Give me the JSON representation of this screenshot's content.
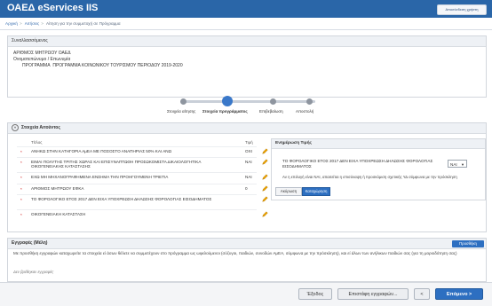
{
  "header": {
    "app_title": "ΟΑΕΔ eServices IIS",
    "logout_label": "Αποσύνδεση χρήστη"
  },
  "breadcrumb": {
    "items": [
      "Αρχική",
      "Αιτήσεις",
      "Αίτηση για την συμμετοχή σε Πρόγραμμα"
    ]
  },
  "applicant": {
    "title": "Συναλλασσόμενος",
    "registry_label": "ΑΡΙΘΜΟΣ ΜΗΤΡΩΟΥ ΟΑΕΔ",
    "name_label": "Ονοματεπώνυμο / Επωνυμία",
    "program_label": "ΠΡΟΓΡΑΜΜΑ",
    "program_value": "ΠΡΟΓΡΑΜΜΑ ΚΟΙΝΩΝΙΚΟΥ ΤΟΥΡΙΣΜΟΥ ΠΕΡΙΟΔΟΥ 2019-2020"
  },
  "wizard": {
    "steps": [
      {
        "label": "Στοιχεία αίτησης",
        "active": false
      },
      {
        "label": "Στοιχεία προγράμματος",
        "active": true
      },
      {
        "label": "Επιβεβαίωση",
        "active": false
      },
      {
        "label": "Αποστολή",
        "active": false
      }
    ]
  },
  "criteria": {
    "title": "Στοιχεία Αιτούντος",
    "col_title": "Τίτλος",
    "col_value": "Τιμή",
    "rows": [
      {
        "star": "*",
        "label": "ΑΝΗΚΩ ΣΤΗΝ ΚΑΤΗΓΟΡΙΑ ΑμΕΑ ΜΕ ΠΟΣΟΣΤΟ ΑΝΑΠΗΡΙΑΣ 50% ΚΑΙ ΑΝΩ",
        "value": "ΟΧΙ"
      },
      {
        "star": "*",
        "label": "ΕΙΜΑΙ ΠΟΛΥΤΗΣ ΤΡΙΤΗΣ ΧΩΡΑΣ ΚΑΙ ΕΠΙΣΥΝΑΠΤΩΘΗ ΠΡΟΣΩΚΟΜΙΣΤΑ ΔΙΚΑΙΟΛΟΓΗΤΙΚΑ ΟΙΚΟΓΕΝΕΙΑΚΗΣ ΚΑΤΑΣΤΑΣΗΣ",
        "value": "ΝΑΙ"
      },
      {
        "star": "*",
        "label": "ΕΧΩ ΜΗ ΜΗΧΑΝΟΓΡΑΦΗΜΕΝΑ ΕΝΣΗΜΑ ΤΗΝ ΠΡΟΗΓΟΥΜΕΝΗ ΤΡΙΕΤΙΑ",
        "value": "ΝΑΙ"
      },
      {
        "star": "*",
        "label": "ΑΡΙΘΜΟΣ ΜΗΤΡΩΟΥ ΕΦΚΑ",
        "value": "0"
      },
      {
        "star": "*",
        "label": "ΤΟ ΦΟΡΟΛΟΓΙΚΟ ΕΤΟΣ 2017 ΔΕΝ ΕΙΧΑ ΥΠΟΧΡΕΩΣΗ ΔΗΛΩΣΗΣ ΦΟΡΟΛΟΓΙΑΣ ΕΙΣΟΔΗΜΑΤΟΣ",
        "value": ""
      },
      {
        "star": "*",
        "label": "ΟΙΚΟΓΕΝΕΙΑΚΗ ΚΑΤΑΣΤΑΣΗ",
        "value": ""
      }
    ]
  },
  "update_value": {
    "title": "Ενημέρωση Τιμής",
    "question": "ΤΟ ΦΟΡΟΛΟΓΙΚΟ ΕΤΟΣ 2017 ΔΕΝ ΕΙΧΑ ΥΠΟΧΡΕΩΣΗ ΔΗΛΩΣΗΣ ΦΟΡΟΛΟΓΙΑΣ ΕΙΣΟΔΗΜΑΤΟΣ",
    "selected": "ΝΑΙ",
    "note": "Αν η επιλογή είναι ΝΑΙ, απαιτείται η επισύναψη ή προσκόμιση σχετικής ΥΔ σύμφωνα με την πρόσκληση",
    "cancel_label": "Ακύρωση",
    "save_label": "Καταχώρηση"
  },
  "attachments": {
    "title": "Εγγραφές (Μέλη)",
    "add_label": "Προσθήκη",
    "description": "Με προσθήκη εγγραφών καταχωρείτε τα στοιχεία εί άσων θέλετε να συμμετέχουν στο πρόγραμμα ως ωφελούμενοι (σύζυγοι, παιδιών, συνοδών ΑμΕΑ, σύμφωνα με την πρόσκληση), και εί άλων των ανήλικων παιδιών σας (για τη μοριοδότηση σας)",
    "empty_text": "Δεν βρέθηκαν εγγραφές"
  },
  "footer": {
    "exit_label": "Έξοδος",
    "edit_label": "Επιστάφη εγγραφών...",
    "prev_label": "<",
    "next_label": "Επόμενο >"
  }
}
